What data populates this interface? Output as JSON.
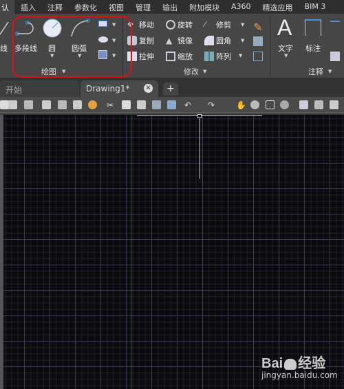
{
  "menu_tabs": [
    "认",
    "插入",
    "注释",
    "参数化",
    "视图",
    "管理",
    "输出",
    "附加模块",
    "A360",
    "精选应用",
    "BIM 3"
  ],
  "draw_panel": {
    "title": "绘图",
    "line_partial": "线",
    "polyline": "多段线",
    "circle": "圆",
    "arc": "圆弧"
  },
  "modify_panel": {
    "title": "修改",
    "move": "移动",
    "rotate": "旋转",
    "trim": "修剪",
    "copy": "复制",
    "mirror": "镜像",
    "fillet": "圆角",
    "stretch": "拉伸",
    "scale": "缩放",
    "array": "阵列"
  },
  "annotation_panel": {
    "title": "注释",
    "text": "文字",
    "dimension": "标注"
  },
  "doc_tabs": [
    {
      "label": "开始"
    },
    {
      "label": "Drawing1*",
      "active": true
    }
  ],
  "new_tab": "+",
  "watermark": {
    "brand": "Bai du 经验",
    "url": "jingyan.baidu.com"
  },
  "colors": {
    "highlight": "#e01010",
    "canvas": "#0b0b0f",
    "y_axis": "#1f6a24"
  }
}
